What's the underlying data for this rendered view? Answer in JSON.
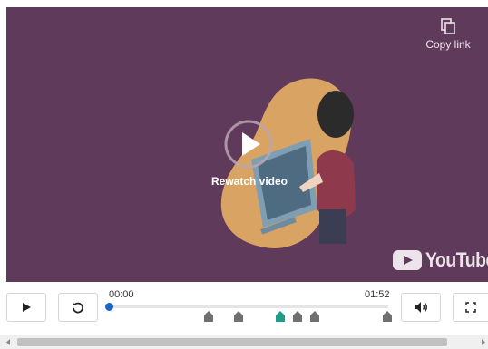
{
  "video": {
    "copy_link_label": "Copy link",
    "overlay_label": "Rewatch video",
    "platform_wordmark": "YouTube",
    "colors": {
      "background": "#603a5a",
      "blob": "#d9a463"
    }
  },
  "controls": {
    "play_icon": "play-icon",
    "replay_icon": "replay-icon",
    "volume_icon": "volume-icon",
    "fullscreen_icon": "fullscreen-icon",
    "current_time": "00:00",
    "duration": "01:52",
    "progress": 0,
    "accent_color": "#1b65c8",
    "active_marker_color": "#1e9e86",
    "marker_color": "#707070"
  }
}
